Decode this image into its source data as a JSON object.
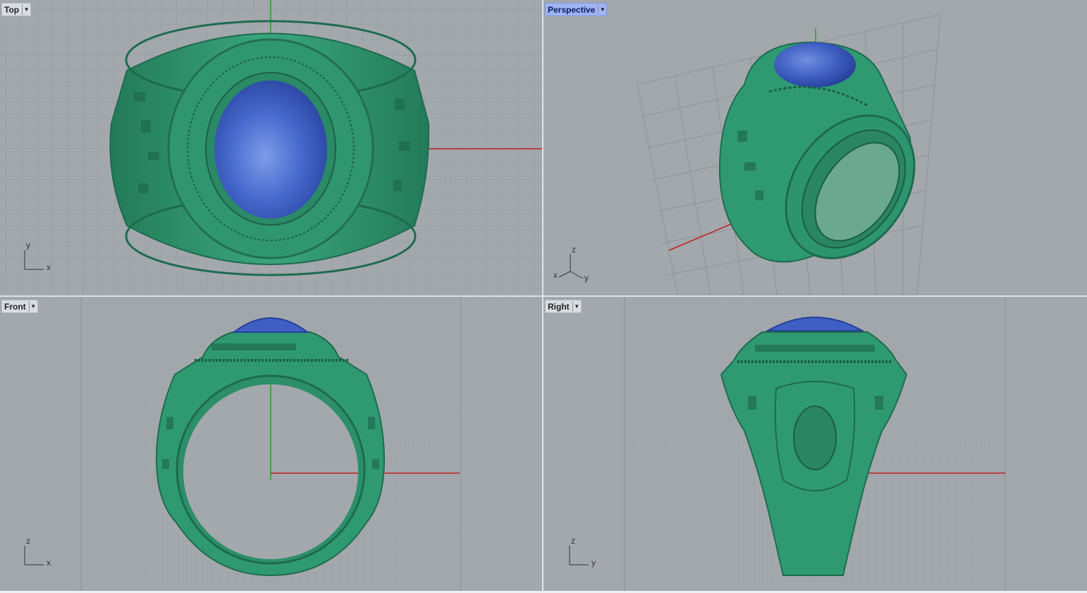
{
  "viewports": {
    "top": {
      "label": "Top",
      "axis_h": "x",
      "axis_v": "y"
    },
    "perspective": {
      "label": "Perspective",
      "axis_x": "x",
      "axis_y": "y",
      "axis_z": "z"
    },
    "front": {
      "label": "Front",
      "axis_h": "x",
      "axis_v": "z"
    },
    "right": {
      "label": "Right",
      "axis_h": "y",
      "axis_v": "z"
    }
  },
  "icons": {
    "viewport_menu": "chevron-down-icon"
  },
  "colors": {
    "viewport_bg": "#a3a8ad",
    "grid": "#8f9498",
    "ring_metal": "#2f9a72",
    "gem": "#3e60c4",
    "x_axis": "#c02020",
    "y_axis": "#20a020",
    "active_label": "#9fb4f0"
  }
}
